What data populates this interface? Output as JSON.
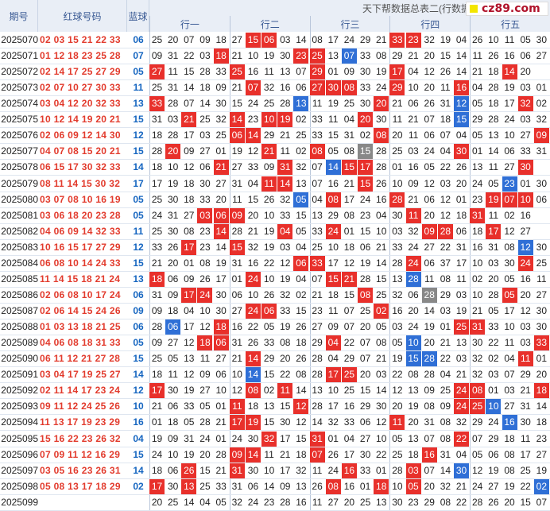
{
  "headers": {
    "issue": "期号",
    "red_numbers": "红球号码",
    "blue_number": "蓝球"
  },
  "banner": "天下帮数据总表二(行数据",
  "watermark": "cz89.com",
  "groups": [
    "行一",
    "行二",
    "行三",
    "行四",
    "行五"
  ],
  "colors": {
    "red_ball": "#e23b2d",
    "blue_ball": "#1565c0",
    "hit_red": "#e8302b",
    "hit_blue": "#2f6fd6",
    "hit_gray": "#888888"
  },
  "chart_data": {
    "type": "table",
    "rows": [
      {
        "issue": "2025070",
        "reds": "02 03 15 21 22 33",
        "blue": "06",
        "cells": [
          "25",
          "20",
          "07",
          "09",
          "18",
          "27",
          "15",
          "06",
          "03",
          "14",
          "08",
          "17",
          "24",
          "29",
          "21",
          "33",
          "23",
          "32",
          "19",
          "04",
          "26",
          "10",
          "11",
          "05",
          "30"
        ],
        "marks": "00000022000000022000000000"
      },
      {
        "issue": "2025071",
        "reds": "01 12 18 23 25 28",
        "blue": "07",
        "cells": [
          "09",
          "31",
          "22",
          "03",
          "18",
          "21",
          "10",
          "19",
          "30",
          "23",
          "25",
          "13",
          "07",
          "33",
          "08",
          "29",
          "21",
          "20",
          "15",
          "14",
          "11",
          "26",
          "16",
          "06",
          "27",
          "12"
        ],
        "marks": "0000200002203000000000000"
      },
      {
        "issue": "2025072",
        "reds": "02 14 17 25 27 29",
        "blue": "05",
        "cells": [
          "27",
          "11",
          "15",
          "28",
          "33",
          "25",
          "16",
          "11",
          "13",
          "07",
          "29",
          "01",
          "09",
          "30",
          "19",
          "17",
          "04",
          "12",
          "26",
          "14",
          "21",
          "18",
          "14",
          "20"
        ],
        "marks": "2000020000200002000000200"
      },
      {
        "issue": "2025073",
        "reds": "02 07 10 27 30 33",
        "blue": "11",
        "cells": [
          "25",
          "31",
          "14",
          "18",
          "09",
          "21",
          "07",
          "32",
          "16",
          "06",
          "27",
          "30",
          "08",
          "33",
          "24",
          "29",
          "10",
          "20",
          "11",
          "16",
          "04",
          "28",
          "19",
          "03",
          "01"
        ],
        "marks": "0000002000222002000200000"
      },
      {
        "issue": "2025074",
        "reds": "03 04 12 20 32 33",
        "blue": "13",
        "cells": [
          "33",
          "28",
          "07",
          "14",
          "30",
          "15",
          "24",
          "25",
          "28",
          "13",
          "11",
          "19",
          "25",
          "30",
          "20",
          "21",
          "06",
          "26",
          "31",
          "12",
          "05",
          "18",
          "17",
          "32",
          "02"
        ],
        "marks": "2000000003000020000300020"
      },
      {
        "issue": "2025075",
        "reds": "10 12 14 19 20 21",
        "blue": "15",
        "cells": [
          "31",
          "03",
          "21",
          "25",
          "32",
          "14",
          "23",
          "10",
          "19",
          "02",
          "33",
          "11",
          "04",
          "20",
          "30",
          "11",
          "21",
          "07",
          "18",
          "15",
          "29",
          "28",
          "24",
          "03",
          "32"
        ],
        "marks": "0020020220000200000300000"
      },
      {
        "issue": "2025076",
        "reds": "02 06 09 12 14 30",
        "blue": "12",
        "cells": [
          "18",
          "28",
          "17",
          "03",
          "25",
          "06",
          "14",
          "29",
          "21",
          "25",
          "33",
          "15",
          "31",
          "02",
          "08",
          "20",
          "11",
          "06",
          "07",
          "04",
          "05",
          "13",
          "10",
          "27",
          "09"
        ],
        "marks": "0000022000000020000000002"
      },
      {
        "issue": "2025077",
        "reds": "04 07 08 15 20 21",
        "blue": "15",
        "cells": [
          "28",
          "20",
          "09",
          "27",
          "01",
          "19",
          "12",
          "21",
          "11",
          "02",
          "08",
          "05",
          "08",
          "15",
          "28",
          "25",
          "03",
          "24",
          "04",
          "30",
          "01",
          "14",
          "06",
          "33",
          "31"
        ],
        "marks": "0200000200200400000200000"
      },
      {
        "issue": "2025078",
        "reds": "06 15 17 30 32 33",
        "blue": "14",
        "cells": [
          "18",
          "10",
          "12",
          "06",
          "21",
          "27",
          "33",
          "09",
          "31",
          "32",
          "07",
          "14",
          "15",
          "17",
          "28",
          "01",
          "16",
          "05",
          "22",
          "26",
          "13",
          "11",
          "27",
          "30"
        ],
        "marks": "0000200020032200000000020"
      },
      {
        "issue": "2025079",
        "reds": "08 11 14 15 30 32",
        "blue": "17",
        "cells": [
          "17",
          "19",
          "18",
          "30",
          "27",
          "31",
          "04",
          "11",
          "14",
          "13",
          "07",
          "16",
          "21",
          "15",
          "26",
          "10",
          "09",
          "12",
          "03",
          "20",
          "24",
          "05",
          "23",
          "01",
          "30"
        ],
        "marks": "0000000220000200000000300"
      },
      {
        "issue": "2025080",
        "reds": "03 07 08 10 16 19",
        "blue": "05",
        "cells": [
          "25",
          "30",
          "18",
          "33",
          "20",
          "11",
          "15",
          "26",
          "32",
          "05",
          "04",
          "08",
          "17",
          "24",
          "16",
          "28",
          "21",
          "06",
          "12",
          "01",
          "23",
          "19",
          "07",
          "10",
          "06"
        ],
        "marks": "0000000003020002000002220"
      },
      {
        "issue": "2025081",
        "reds": "03 06 18 20 23 28",
        "blue": "05",
        "cells": [
          "24",
          "31",
          "27",
          "03",
          "06",
          "09",
          "20",
          "10",
          "33",
          "15",
          "13",
          "29",
          "08",
          "23",
          "04",
          "30",
          "11",
          "20",
          "12",
          "18",
          "31",
          "11",
          "02",
          "16"
        ],
        "marks": "0002220000000000200020000"
      },
      {
        "issue": "2025082",
        "reds": "04 06 09 14 32 33",
        "blue": "11",
        "cells": [
          "25",
          "30",
          "08",
          "23",
          "14",
          "28",
          "21",
          "19",
          "04",
          "05",
          "33",
          "24",
          "01",
          "15",
          "10",
          "03",
          "32",
          "09",
          "28",
          "06",
          "18",
          "17",
          "12",
          "27"
        ],
        "marks": "0000200020020000022002000"
      },
      {
        "issue": "2025083",
        "reds": "10 16 15 17 27 29",
        "blue": "12",
        "cells": [
          "33",
          "26",
          "17",
          "23",
          "14",
          "15",
          "32",
          "19",
          "03",
          "04",
          "25",
          "10",
          "18",
          "06",
          "21",
          "33",
          "24",
          "27",
          "22",
          "31",
          "16",
          "31",
          "08",
          "12",
          "30"
        ],
        "marks": "0020020000000000000000030"
      },
      {
        "issue": "2025084",
        "reds": "06 08 10 14 24 33",
        "blue": "15",
        "cells": [
          "21",
          "20",
          "01",
          "08",
          "19",
          "31",
          "16",
          "22",
          "12",
          "06",
          "33",
          "17",
          "12",
          "19",
          "14",
          "28",
          "24",
          "06",
          "37",
          "17",
          "10",
          "03",
          "30",
          "24",
          "25"
        ],
        "marks": "0000000002200000200000020"
      },
      {
        "issue": "2025085",
        "reds": "11 14 15 18 21 24",
        "blue": "13",
        "cells": [
          "18",
          "06",
          "09",
          "26",
          "17",
          "01",
          "24",
          "10",
          "19",
          "04",
          "07",
          "15",
          "21",
          "28",
          "15",
          "13",
          "28",
          "11",
          "08",
          "11",
          "02",
          "20",
          "05",
          "16",
          "11"
        ],
        "marks": "2000002000022000300000000"
      },
      {
        "issue": "2025086",
        "reds": "02 06 08 10 17 24",
        "blue": "06",
        "cells": [
          "31",
          "09",
          "17",
          "24",
          "30",
          "06",
          "10",
          "26",
          "32",
          "02",
          "21",
          "18",
          "15",
          "08",
          "25",
          "32",
          "06",
          "28",
          "29",
          "03",
          "10",
          "28",
          "05",
          "20",
          "27"
        ],
        "marks": "0022000000000200040000200"
      },
      {
        "issue": "2025087",
        "reds": "02 06 14 15 24 26",
        "blue": "09",
        "cells": [
          "09",
          "18",
          "04",
          "10",
          "30",
          "27",
          "24",
          "06",
          "33",
          "15",
          "23",
          "11",
          "07",
          "25",
          "02",
          "16",
          "20",
          "14",
          "03",
          "19",
          "21",
          "05",
          "17",
          "12",
          "30"
        ],
        "marks": "0000002200000020000000000"
      },
      {
        "issue": "2025088",
        "reds": "01 03 13 18 21 25",
        "blue": "06",
        "cells": [
          "28",
          "06",
          "17",
          "12",
          "18",
          "16",
          "22",
          "05",
          "19",
          "26",
          "27",
          "09",
          "07",
          "20",
          "05",
          "03",
          "24",
          "19",
          "01",
          "25",
          "31",
          "33",
          "10",
          "03",
          "30"
        ],
        "marks": "0300200000000000000220000"
      },
      {
        "issue": "2025089",
        "reds": "04 06 08 18 31 33",
        "blue": "05",
        "cells": [
          "09",
          "27",
          "12",
          "18",
          "06",
          "31",
          "26",
          "33",
          "08",
          "18",
          "29",
          "04",
          "22",
          "07",
          "08",
          "05",
          "10",
          "20",
          "21",
          "13",
          "30",
          "22",
          "11",
          "03",
          "33"
        ],
        "marks": "0002200000020000300000002"
      },
      {
        "issue": "2025090",
        "reds": "06 11 12 21 27 28",
        "blue": "15",
        "cells": [
          "25",
          "05",
          "13",
          "11",
          "27",
          "21",
          "14",
          "29",
          "20",
          "26",
          "28",
          "04",
          "29",
          "07",
          "21",
          "19",
          "15",
          "28",
          "22",
          "03",
          "32",
          "02",
          "04",
          "11",
          "01"
        ],
        "marks": "0000002000000000330000020"
      },
      {
        "issue": "2025091",
        "reds": "03 04 17 19 25 27",
        "blue": "14",
        "cells": [
          "18",
          "11",
          "12",
          "09",
          "06",
          "10",
          "14",
          "15",
          "22",
          "08",
          "28",
          "17",
          "25",
          "20",
          "03",
          "22",
          "08",
          "28",
          "04",
          "21",
          "32",
          "03",
          "07",
          "29",
          "20"
        ],
        "marks": "0000003000022000000000000"
      },
      {
        "issue": "2025092",
        "reds": "02 11 14 17 23 24",
        "blue": "12",
        "cells": [
          "17",
          "30",
          "19",
          "27",
          "10",
          "12",
          "08",
          "02",
          "11",
          "14",
          "13",
          "10",
          "25",
          "15",
          "14",
          "12",
          "13",
          "09",
          "25",
          "24",
          "08",
          "01",
          "03",
          "21",
          "18"
        ],
        "marks": "2000002020000000000220002"
      },
      {
        "issue": "2025093",
        "reds": "09 11 12 24 25 26",
        "blue": "10",
        "cells": [
          "21",
          "06",
          "33",
          "05",
          "01",
          "11",
          "18",
          "13",
          "15",
          "12",
          "28",
          "17",
          "16",
          "29",
          "30",
          "20",
          "19",
          "08",
          "09",
          "24",
          "25",
          "10",
          "27",
          "31",
          "14"
        ],
        "marks": "0000020002000000000223000"
      },
      {
        "issue": "2025094",
        "reds": "11 13 17 19 23 29",
        "blue": "16",
        "cells": [
          "01",
          "18",
          "05",
          "28",
          "21",
          "17",
          "19",
          "15",
          "30",
          "12",
          "14",
          "32",
          "33",
          "06",
          "12",
          "11",
          "20",
          "31",
          "08",
          "32",
          "29",
          "24",
          "16",
          "30",
          "18"
        ],
        "marks": "0000022000000002000000300"
      },
      {
        "issue": "2025095",
        "reds": "15 16 22 23 26 32",
        "blue": "04",
        "cells": [
          "19",
          "09",
          "31",
          "24",
          "01",
          "24",
          "30",
          "32",
          "17",
          "15",
          "31",
          "01",
          "04",
          "27",
          "10",
          "05",
          "13",
          "07",
          "08",
          "22",
          "07",
          "29",
          "18",
          "11",
          "23"
        ],
        "marks": "0000000200200000000200000"
      },
      {
        "issue": "2025096",
        "reds": "07 09 11 12 16 29",
        "blue": "15",
        "cells": [
          "24",
          "10",
          "19",
          "20",
          "28",
          "09",
          "14",
          "11",
          "21",
          "18",
          "07",
          "26",
          "17",
          "30",
          "22",
          "25",
          "18",
          "16",
          "31",
          "04",
          "05",
          "06",
          "08",
          "17",
          "27"
        ],
        "marks": "0000022000200000020000000"
      },
      {
        "issue": "2025097",
        "reds": "03 05 16 23 26 31",
        "blue": "14",
        "cells": [
          "18",
          "06",
          "26",
          "15",
          "21",
          "31",
          "30",
          "10",
          "17",
          "32",
          "11",
          "24",
          "16",
          "33",
          "01",
          "28",
          "03",
          "07",
          "14",
          "30",
          "12",
          "19",
          "08",
          "25",
          "19"
        ],
        "marks": "0020020000002000200300000"
      },
      {
        "issue": "2025098",
        "reds": "05 08 13 17 18 29",
        "blue": "02",
        "cells": [
          "17",
          "30",
          "13",
          "25",
          "33",
          "31",
          "06",
          "14",
          "09",
          "13",
          "26",
          "08",
          "16",
          "01",
          "18",
          "10",
          "05",
          "20",
          "32",
          "21",
          "24",
          "27",
          "19",
          "22",
          "02"
        ],
        "marks": "2020000000020020200000003"
      },
      {
        "issue": "2025099",
        "reds": "",
        "blue": "",
        "cells": [
          "20",
          "25",
          "14",
          "04",
          "05",
          "32",
          "24",
          "23",
          "28",
          "16",
          "11",
          "27",
          "20",
          "25",
          "13",
          "30",
          "23",
          "29",
          "08",
          "22",
          "28",
          "26",
          "20",
          "15",
          "07"
        ],
        "marks": "0000000000000000000000000"
      }
    ]
  }
}
